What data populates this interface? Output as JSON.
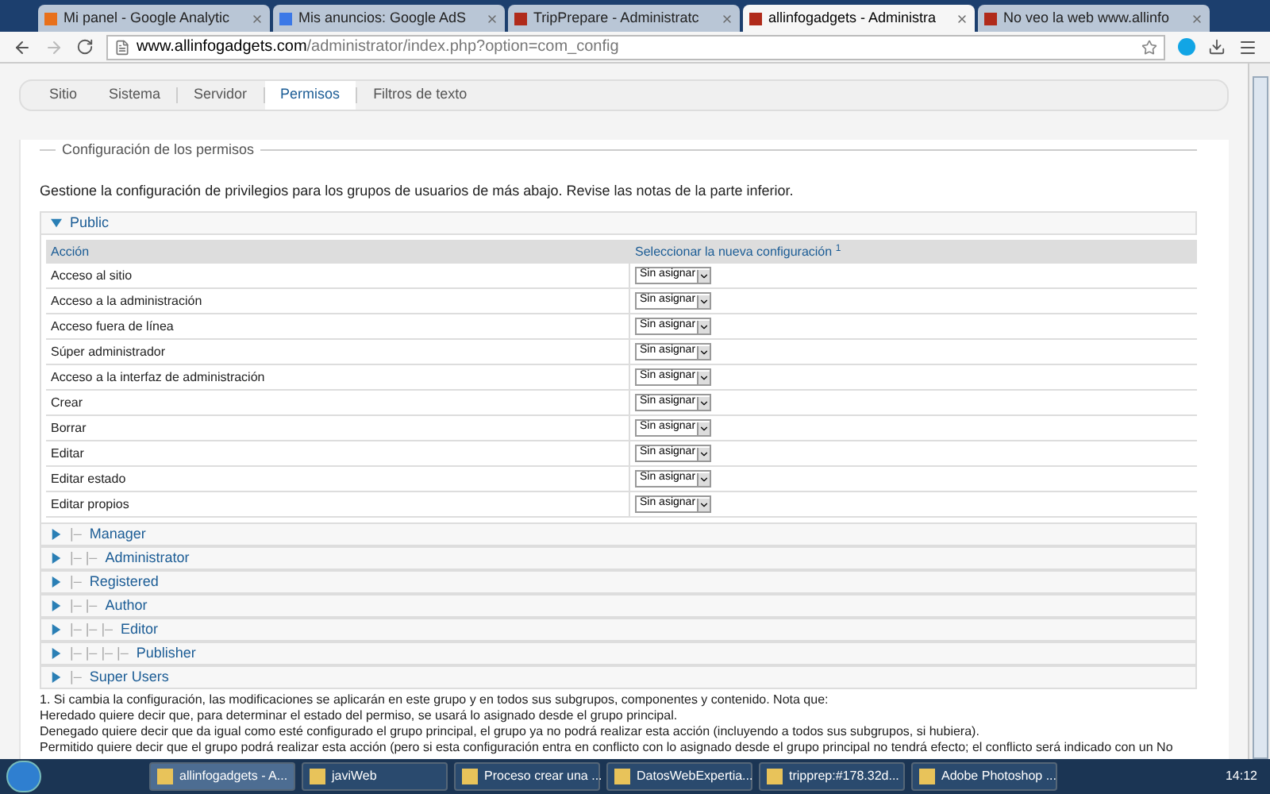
{
  "browser_tabs": [
    {
      "label": "Mi panel - Google Analytic",
      "selected": false,
      "color": "#e8701a"
    },
    {
      "label": "Mis anuncios: Google AdS",
      "selected": false,
      "color": "#3b78e7"
    },
    {
      "label": "TripPrepare - Administratc",
      "selected": false,
      "color": "#b02a1a"
    },
    {
      "label": "allinfogadgets - Administra",
      "selected": true,
      "color": "#b02a1a"
    },
    {
      "label": "No veo la web www.allinfo",
      "selected": false,
      "color": "#b02a1a"
    }
  ],
  "address": {
    "domain": "www.allinfogadgets.com",
    "path": "/administrator/index.php?option=com_config"
  },
  "config_tabs": [
    {
      "label": "Sitio",
      "selected": false
    },
    {
      "label": "Sistema",
      "selected": false
    },
    {
      "label": "Servidor",
      "selected": false
    },
    {
      "label": "Permisos",
      "selected": true
    },
    {
      "label": "Filtros de texto",
      "selected": false
    }
  ],
  "fieldset": {
    "legend": "Configuración de los permisos",
    "intro": "Gestione la configuración de privilegios para los grupos de usuarios de más abajo. Revise las notas de la parte inferior."
  },
  "groups": [
    {
      "name": "Public",
      "expanded": true
    },
    {
      "name": "Manager",
      "prefix": "|–",
      "expanded": false
    },
    {
      "name": "Administrator",
      "prefix": "|– |–",
      "expanded": false
    },
    {
      "name": "Registered",
      "prefix": "|–",
      "expanded": false
    },
    {
      "name": "Author",
      "prefix": "|– |–",
      "expanded": false
    },
    {
      "name": "Editor",
      "prefix": "|– |– |–",
      "expanded": false
    },
    {
      "name": "Publisher",
      "prefix": "|– |– |– |–",
      "expanded": false
    },
    {
      "name": "Super Users",
      "prefix": "|–",
      "expanded": false
    }
  ],
  "table": {
    "columns": [
      "Acción",
      "Seleccionar la nueva configuración"
    ],
    "footnote": "1",
    "rows": [
      {
        "action": "Acceso al sitio",
        "value": "Sin asignar"
      },
      {
        "action": "Acceso a la administración",
        "value": "Sin asignar"
      },
      {
        "action": "Acceso fuera de línea",
        "value": "Sin asignar"
      },
      {
        "action": "Súper administrador",
        "value": "Sin asignar"
      },
      {
        "action": "Acceso a la interfaz de administración",
        "value": "Sin asignar"
      },
      {
        "action": "Crear",
        "value": "Sin asignar"
      },
      {
        "action": "Borrar",
        "value": "Sin asignar"
      },
      {
        "action": "Editar",
        "value": "Sin asignar"
      },
      {
        "action": "Editar estado",
        "value": "Sin asignar"
      },
      {
        "action": "Editar propios",
        "value": "Sin asignar"
      }
    ]
  },
  "notes": [
    "1. Si cambia la configuración, las modificaciones se aplicarán en este grupo y en todos sus subgrupos, componentes y contenido. Nota que:",
    "Heredado quiere decir que, para determinar el estado del permiso, se usará lo asignado desde el grupo principal.",
    "Denegado quiere decir que da igual como esté configurado el grupo principal, el grupo ya no podrá realizar esta acción (incluyendo a todos sus subgrupos, si hubiera).",
    "Permitido quiere decir que el grupo podrá realizar esta acción (pero si esta configuración entra en conflicto con lo asignado desde el grupo principal no tendrá efecto; el conflicto será indicado con un No"
  ],
  "taskbar": {
    "items": [
      {
        "label": "allinfogadgets - A...",
        "selected": true
      },
      {
        "label": "javiWeb",
        "selected": false
      },
      {
        "label": "Proceso crear una ...",
        "selected": false
      },
      {
        "label": "DatosWebExpertia...",
        "selected": false
      },
      {
        "label": "tripprep:#178.32d...",
        "selected": false
      },
      {
        "label": "Adobe Photoshop ...",
        "selected": false
      }
    ],
    "time": "14:12"
  }
}
